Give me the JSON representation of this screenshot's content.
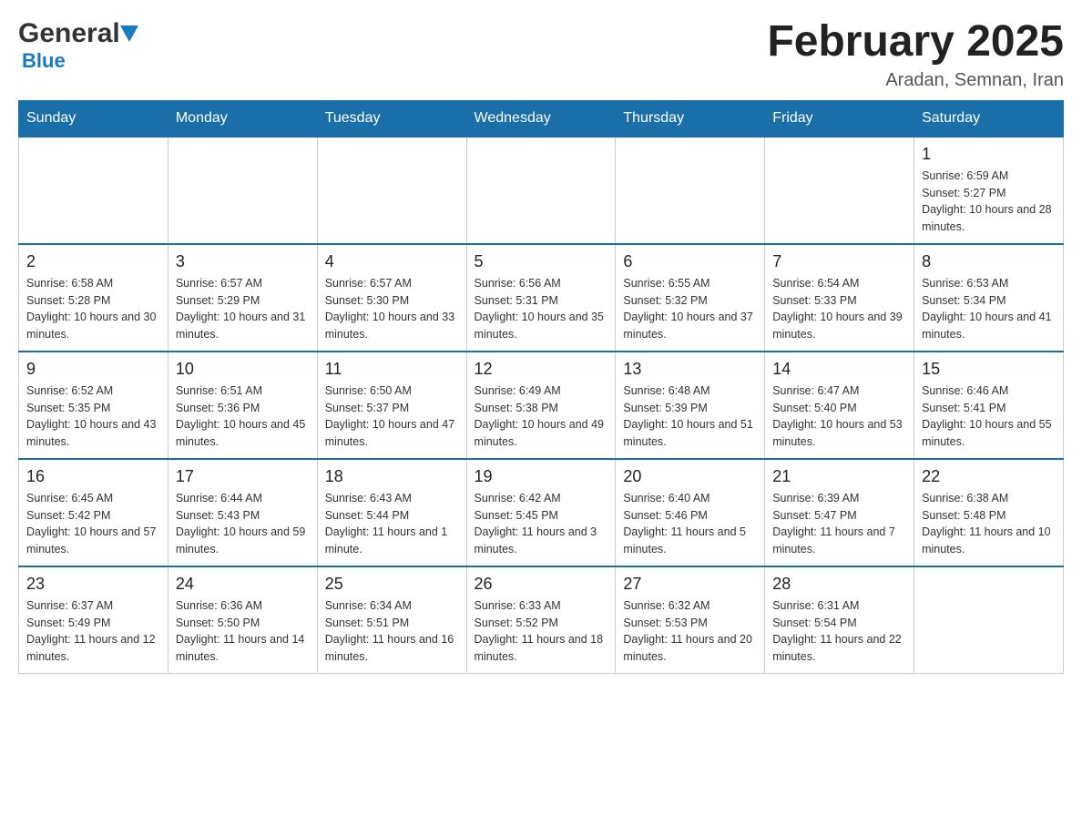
{
  "header": {
    "logo": {
      "general": "General",
      "blue": "Blue"
    },
    "title": "February 2025",
    "location": "Aradan, Semnan, Iran"
  },
  "days_of_week": [
    "Sunday",
    "Monday",
    "Tuesday",
    "Wednesday",
    "Thursday",
    "Friday",
    "Saturday"
  ],
  "weeks": [
    [
      {
        "day": "",
        "info": ""
      },
      {
        "day": "",
        "info": ""
      },
      {
        "day": "",
        "info": ""
      },
      {
        "day": "",
        "info": ""
      },
      {
        "day": "",
        "info": ""
      },
      {
        "day": "",
        "info": ""
      },
      {
        "day": "1",
        "info": "Sunrise: 6:59 AM\nSunset: 5:27 PM\nDaylight: 10 hours and 28 minutes."
      }
    ],
    [
      {
        "day": "2",
        "info": "Sunrise: 6:58 AM\nSunset: 5:28 PM\nDaylight: 10 hours and 30 minutes."
      },
      {
        "day": "3",
        "info": "Sunrise: 6:57 AM\nSunset: 5:29 PM\nDaylight: 10 hours and 31 minutes."
      },
      {
        "day": "4",
        "info": "Sunrise: 6:57 AM\nSunset: 5:30 PM\nDaylight: 10 hours and 33 minutes."
      },
      {
        "day": "5",
        "info": "Sunrise: 6:56 AM\nSunset: 5:31 PM\nDaylight: 10 hours and 35 minutes."
      },
      {
        "day": "6",
        "info": "Sunrise: 6:55 AM\nSunset: 5:32 PM\nDaylight: 10 hours and 37 minutes."
      },
      {
        "day": "7",
        "info": "Sunrise: 6:54 AM\nSunset: 5:33 PM\nDaylight: 10 hours and 39 minutes."
      },
      {
        "day": "8",
        "info": "Sunrise: 6:53 AM\nSunset: 5:34 PM\nDaylight: 10 hours and 41 minutes."
      }
    ],
    [
      {
        "day": "9",
        "info": "Sunrise: 6:52 AM\nSunset: 5:35 PM\nDaylight: 10 hours and 43 minutes."
      },
      {
        "day": "10",
        "info": "Sunrise: 6:51 AM\nSunset: 5:36 PM\nDaylight: 10 hours and 45 minutes."
      },
      {
        "day": "11",
        "info": "Sunrise: 6:50 AM\nSunset: 5:37 PM\nDaylight: 10 hours and 47 minutes."
      },
      {
        "day": "12",
        "info": "Sunrise: 6:49 AM\nSunset: 5:38 PM\nDaylight: 10 hours and 49 minutes."
      },
      {
        "day": "13",
        "info": "Sunrise: 6:48 AM\nSunset: 5:39 PM\nDaylight: 10 hours and 51 minutes."
      },
      {
        "day": "14",
        "info": "Sunrise: 6:47 AM\nSunset: 5:40 PM\nDaylight: 10 hours and 53 minutes."
      },
      {
        "day": "15",
        "info": "Sunrise: 6:46 AM\nSunset: 5:41 PM\nDaylight: 10 hours and 55 minutes."
      }
    ],
    [
      {
        "day": "16",
        "info": "Sunrise: 6:45 AM\nSunset: 5:42 PM\nDaylight: 10 hours and 57 minutes."
      },
      {
        "day": "17",
        "info": "Sunrise: 6:44 AM\nSunset: 5:43 PM\nDaylight: 10 hours and 59 minutes."
      },
      {
        "day": "18",
        "info": "Sunrise: 6:43 AM\nSunset: 5:44 PM\nDaylight: 11 hours and 1 minute."
      },
      {
        "day": "19",
        "info": "Sunrise: 6:42 AM\nSunset: 5:45 PM\nDaylight: 11 hours and 3 minutes."
      },
      {
        "day": "20",
        "info": "Sunrise: 6:40 AM\nSunset: 5:46 PM\nDaylight: 11 hours and 5 minutes."
      },
      {
        "day": "21",
        "info": "Sunrise: 6:39 AM\nSunset: 5:47 PM\nDaylight: 11 hours and 7 minutes."
      },
      {
        "day": "22",
        "info": "Sunrise: 6:38 AM\nSunset: 5:48 PM\nDaylight: 11 hours and 10 minutes."
      }
    ],
    [
      {
        "day": "23",
        "info": "Sunrise: 6:37 AM\nSunset: 5:49 PM\nDaylight: 11 hours and 12 minutes."
      },
      {
        "day": "24",
        "info": "Sunrise: 6:36 AM\nSunset: 5:50 PM\nDaylight: 11 hours and 14 minutes."
      },
      {
        "day": "25",
        "info": "Sunrise: 6:34 AM\nSunset: 5:51 PM\nDaylight: 11 hours and 16 minutes."
      },
      {
        "day": "26",
        "info": "Sunrise: 6:33 AM\nSunset: 5:52 PM\nDaylight: 11 hours and 18 minutes."
      },
      {
        "day": "27",
        "info": "Sunrise: 6:32 AM\nSunset: 5:53 PM\nDaylight: 11 hours and 20 minutes."
      },
      {
        "day": "28",
        "info": "Sunrise: 6:31 AM\nSunset: 5:54 PM\nDaylight: 11 hours and 22 minutes."
      },
      {
        "day": "",
        "info": ""
      }
    ]
  ]
}
